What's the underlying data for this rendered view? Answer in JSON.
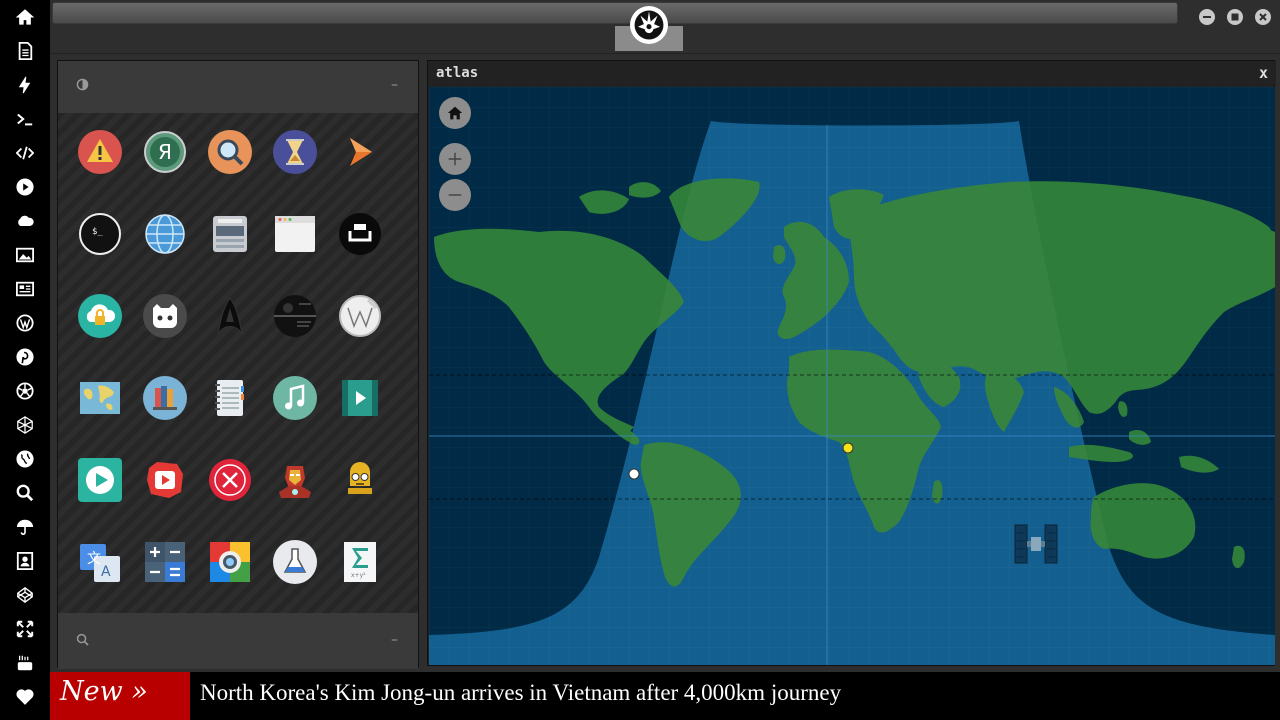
{
  "dock": {
    "items": [
      {
        "icon": "home-icon"
      },
      {
        "icon": "document-icon"
      },
      {
        "icon": "bolt-icon"
      },
      {
        "icon": "terminal-icon"
      },
      {
        "icon": "code-icon"
      },
      {
        "icon": "play-circle-icon"
      },
      {
        "icon": "cloud-icon"
      },
      {
        "icon": "image-icon"
      },
      {
        "icon": "newspaper-icon"
      },
      {
        "icon": "wordpress-icon"
      },
      {
        "icon": "pinterest-icon"
      },
      {
        "icon": "aperture-icon"
      },
      {
        "icon": "mesh-icon"
      },
      {
        "icon": "globe-icon"
      },
      {
        "icon": "search-icon"
      },
      {
        "icon": "umbrella-icon"
      },
      {
        "icon": "contact-card-icon"
      },
      {
        "icon": "codepen-icon"
      },
      {
        "icon": "fullscreen-icon"
      },
      {
        "icon": "youtube-icon"
      },
      {
        "icon": "heart-icon"
      }
    ]
  },
  "topbar": {
    "emblem_icon": "rebel-alliance-icon",
    "window_buttons": [
      "minimize-icon",
      "maximize-icon",
      "close-icon"
    ]
  },
  "launcher": {
    "header_icon": "contrast-icon",
    "header_button": "–",
    "footer_icon": "search-icon",
    "footer_button": "–",
    "apps": [
      {
        "icon": "warning-icon"
      },
      {
        "icon": "yandex-icon"
      },
      {
        "icon": "magnifier-icon"
      },
      {
        "icon": "hourglass-icon"
      },
      {
        "icon": "arrow-forward-icon"
      },
      {
        "icon": "terminal-app-icon"
      },
      {
        "icon": "globe-app-icon"
      },
      {
        "icon": "scanner-icon"
      },
      {
        "icon": "browser-window-icon"
      },
      {
        "icon": "quote-icon"
      },
      {
        "icon": "cloud-lock-icon"
      },
      {
        "icon": "github-icon"
      },
      {
        "icon": "starfleet-icon"
      },
      {
        "icon": "death-star-icon"
      },
      {
        "icon": "wikipedia-icon"
      },
      {
        "icon": "map-app-icon"
      },
      {
        "icon": "books-icon"
      },
      {
        "icon": "notebook-icon"
      },
      {
        "icon": "music-icon"
      },
      {
        "icon": "video-icon"
      },
      {
        "icon": "play-store-icon"
      },
      {
        "icon": "youtube-app-icon"
      },
      {
        "icon": "cancel-icon"
      },
      {
        "icon": "iron-man-icon"
      },
      {
        "icon": "c3po-icon"
      },
      {
        "icon": "translate-icon"
      },
      {
        "icon": "calculator-icon"
      },
      {
        "icon": "photo-camera-icon"
      },
      {
        "icon": "flask-icon"
      },
      {
        "icon": "sigma-icon"
      }
    ]
  },
  "atlas": {
    "title": "atlas",
    "close_label": "x",
    "controls": [
      "home-icon",
      "zoom-in-icon",
      "zoom-out-icon"
    ],
    "colors": {
      "ocean_night": "#002a45",
      "ocean_day": "#0a5a8c",
      "land": "#2e7d3a"
    },
    "satellite_icon": "satellite-icon"
  },
  "ticker": {
    "badge": "New »",
    "headline": "North Korea's Kim Jong-un arrives in Vietnam after 4,000km journey"
  }
}
